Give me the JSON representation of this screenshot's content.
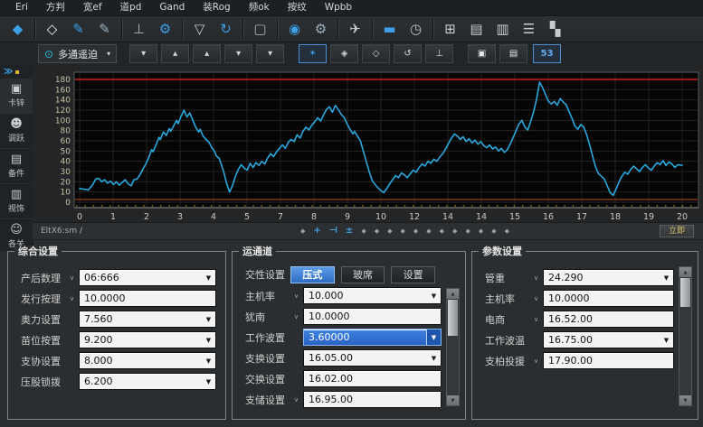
{
  "menu": {
    "items": [
      "Eri",
      "方判",
      "宽ef",
      "道pd",
      "Gand",
      "装Rog",
      "频ok",
      "按纹",
      "Wpbb"
    ]
  },
  "toolbar_main": {
    "items": [
      {
        "name": "app-home-button",
        "icon": "diamond-solid-icon",
        "glyph": "◆",
        "color": "#3d9fe6"
      },
      {
        "sep": true
      },
      {
        "name": "select-tool-button",
        "icon": "diamond-outline-icon",
        "glyph": "◇",
        "color": "#e8ebed"
      },
      {
        "name": "edit-pen-button",
        "icon": "pen-icon",
        "glyph": "✎",
        "color": "#3d9fe6"
      },
      {
        "name": "annotate-pen-button",
        "icon": "pen-icon",
        "glyph": "✎",
        "color": "#9fb2bf"
      },
      {
        "sep": true
      },
      {
        "name": "probe-tool-button",
        "icon": "probe-icon",
        "glyph": "⊥",
        "color": "#aab6be"
      },
      {
        "name": "gear-settings-button",
        "icon": "gear-icon",
        "glyph": "⚙",
        "color": "#3d9fe6"
      },
      {
        "sep": true
      },
      {
        "name": "shield-button",
        "icon": "shield-icon",
        "glyph": "▽",
        "color": "#c6cdd2"
      },
      {
        "name": "refresh-button",
        "icon": "refresh-icon",
        "glyph": "↻",
        "color": "#3d9fe6"
      },
      {
        "sep": true
      },
      {
        "name": "monitor-button",
        "icon": "monitor-icon",
        "glyph": "▢",
        "color": "#9fb2bf"
      },
      {
        "sep": true
      },
      {
        "name": "snapshot-button",
        "icon": "camera-icon",
        "glyph": "◉",
        "color": "#3d9fe6"
      },
      {
        "name": "wrench-button",
        "icon": "wrench-icon",
        "glyph": "⚙",
        "color": "#9fb2bf"
      },
      {
        "sep": true
      },
      {
        "name": "flight-button",
        "icon": "plane-icon",
        "glyph": "✈",
        "color": "#c6cdd2"
      },
      {
        "sep": true
      },
      {
        "name": "card-button",
        "icon": "card-icon",
        "glyph": "▬",
        "color": "#3d9fe6"
      },
      {
        "name": "clock-button",
        "icon": "clock-icon",
        "glyph": "◷",
        "color": "#b9c2c8"
      },
      {
        "sep": true
      },
      {
        "name": "calendar-button",
        "icon": "calendar-icon",
        "glyph": "⊞",
        "color": "#c6cdd2"
      },
      {
        "name": "document-button",
        "icon": "document-icon",
        "glyph": "▤",
        "color": "#c6cdd2"
      },
      {
        "name": "report-button",
        "icon": "report-icon",
        "glyph": "▥",
        "color": "#c6cdd2"
      },
      {
        "name": "list-menu-button",
        "icon": "hamburger-icon",
        "glyph": "☰",
        "color": "#c6cdd2"
      },
      {
        "name": "layout-grid-button",
        "icon": "blocks-icon",
        "glyph": "▚",
        "color": "#c6cdd2"
      }
    ]
  },
  "toolbar_chart": {
    "combo_icon": "pin-circle-icon",
    "combo_label": "多通遥迫",
    "items": [
      {
        "name": "chevron-down-button-1",
        "icon": "chevron-down-icon",
        "glyph": "▾",
        "color": "#cfd6da"
      },
      {
        "name": "marker-up-button",
        "icon": "arrow-up-icon",
        "glyph": "▴",
        "color": "#cfd6da"
      },
      {
        "name": "marker-top-button",
        "icon": "arrow-up-icon",
        "glyph": "▴",
        "color": "#cfd6da"
      },
      {
        "name": "chevron-down-button-2",
        "icon": "chevron-down-icon",
        "glyph": "▾",
        "color": "#cfd6da"
      },
      {
        "name": "chevron-down-button-3",
        "icon": "chevron-down-icon",
        "glyph": "▾",
        "color": "#cfd6da"
      },
      {
        "gap": true
      },
      {
        "name": "burst-tool-button",
        "icon": "burst-icon",
        "glyph": "✶",
        "color": "#3d9fe6",
        "active": true
      },
      {
        "name": "diamond-marker-button",
        "icon": "diamond-dot-icon",
        "glyph": "◈",
        "color": "#cfd6da"
      },
      {
        "name": "diamond-outline-button",
        "icon": "diamond-outline-icon",
        "glyph": "◇",
        "color": "#cfd6da"
      },
      {
        "name": "rotate-ccw-button",
        "icon": "rotate-ccw-icon",
        "glyph": "↺",
        "color": "#cfd6da"
      },
      {
        "name": "ground-button",
        "icon": "ground-icon",
        "glyph": "⊥",
        "color": "#cfd6da"
      },
      {
        "gap": true
      },
      {
        "name": "window-mode-button",
        "icon": "window-icon",
        "glyph": "▣",
        "color": "#e2e5e7"
      },
      {
        "name": "panel-mode-button",
        "icon": "panel-icon",
        "glyph": "▤",
        "color": "#e2e5e7"
      }
    ],
    "badge_label": "53",
    "badge_color": "#5fa9ef"
  },
  "sidebar": {
    "expander_blue": "≫",
    "expander_yellow": "▪",
    "items": [
      {
        "icon": "lock-icon",
        "glyph": "▣",
        "label": "卡锌"
      },
      {
        "icon": "user-icon",
        "glyph": "☻",
        "label": "调跃"
      },
      {
        "icon": "card-icon",
        "glyph": "▤",
        "label": "备件"
      },
      {
        "icon": "news-icon",
        "glyph": "▥",
        "label": "视饰"
      },
      {
        "icon": "person-icon",
        "glyph": "☺",
        "label": "各关"
      }
    ]
  },
  "chart_data": {
    "type": "line",
    "title": "",
    "xlabel": "",
    "ylabel": "",
    "x_ticks": [
      "0",
      "1",
      "2",
      "3",
      "4",
      "5",
      "7",
      "8",
      "9",
      "10",
      "12",
      "14",
      "14",
      "15",
      "16",
      "17",
      "18",
      "19",
      "20"
    ],
    "y_ticks": [
      "180",
      "160",
      "140",
      "120",
      "100",
      "80",
      "60",
      "50",
      "40",
      "30",
      "20",
      "10",
      "0"
    ],
    "x_domain": [
      0,
      20.5
    ],
    "y_domain": [
      0,
      190
    ],
    "grid": true,
    "legend": "none",
    "line_color": "#2aa7dd",
    "threshold_high": 180,
    "threshold_high_color": "#c8221a",
    "threshold_low": 4,
    "threshold_low_color": "#8f3a18",
    "minor_tick_color": "#b9861e",
    "points": [
      [
        0,
        20
      ],
      [
        0.15,
        19
      ],
      [
        0.3,
        18
      ],
      [
        0.45,
        26
      ],
      [
        0.55,
        34
      ],
      [
        0.65,
        35
      ],
      [
        0.75,
        30
      ],
      [
        0.85,
        33
      ],
      [
        0.95,
        28
      ],
      [
        1.05,
        31
      ],
      [
        1.15,
        26
      ],
      [
        1.25,
        30
      ],
      [
        1.35,
        25
      ],
      [
        1.45,
        29
      ],
      [
        1.55,
        33
      ],
      [
        1.65,
        27
      ],
      [
        1.75,
        24
      ],
      [
        1.85,
        33
      ],
      [
        1.95,
        34
      ],
      [
        2.05,
        40
      ],
      [
        2.15,
        48
      ],
      [
        2.25,
        56
      ],
      [
        2.35,
        65
      ],
      [
        2.45,
        77
      ],
      [
        2.5,
        74
      ],
      [
        2.6,
        84
      ],
      [
        2.7,
        95
      ],
      [
        2.75,
        92
      ],
      [
        2.85,
        103
      ],
      [
        2.95,
        98
      ],
      [
        3.05,
        108
      ],
      [
        3.1,
        104
      ],
      [
        3.2,
        112
      ],
      [
        3.3,
        120
      ],
      [
        3.35,
        115
      ],
      [
        3.45,
        126
      ],
      [
        3.55,
        135
      ],
      [
        3.65,
        125
      ],
      [
        3.75,
        131
      ],
      [
        3.85,
        120
      ],
      [
        3.95,
        110
      ],
      [
        4.05,
        103
      ],
      [
        4.1,
        107
      ],
      [
        4.2,
        97
      ],
      [
        4.3,
        92
      ],
      [
        4.4,
        88
      ],
      [
        4.5,
        80
      ],
      [
        4.6,
        74
      ],
      [
        4.65,
        68
      ],
      [
        4.75,
        64
      ],
      [
        4.8,
        58
      ],
      [
        4.9,
        45
      ],
      [
        5.0,
        28
      ],
      [
        5.1,
        15
      ],
      [
        5.2,
        24
      ],
      [
        5.3,
        38
      ],
      [
        5.4,
        48
      ],
      [
        5.5,
        55
      ],
      [
        5.6,
        50
      ],
      [
        5.7,
        47
      ],
      [
        5.8,
        57
      ],
      [
        5.9,
        51
      ],
      [
        6.0,
        58
      ],
      [
        6.1,
        54
      ],
      [
        6.2,
        60
      ],
      [
        6.3,
        56
      ],
      [
        6.4,
        65
      ],
      [
        6.5,
        71
      ],
      [
        6.6,
        67
      ],
      [
        6.7,
        74
      ],
      [
        6.8,
        79
      ],
      [
        6.9,
        84
      ],
      [
        7.0,
        79
      ],
      [
        7.1,
        88
      ],
      [
        7.2,
        92
      ],
      [
        7.3,
        89
      ],
      [
        7.4,
        99
      ],
      [
        7.5,
        94
      ],
      [
        7.6,
        104
      ],
      [
        7.7,
        110
      ],
      [
        7.8,
        106
      ],
      [
        7.9,
        113
      ],
      [
        8.0,
        118
      ],
      [
        8.1,
        124
      ],
      [
        8.2,
        119
      ],
      [
        8.3,
        128
      ],
      [
        8.4,
        136
      ],
      [
        8.5,
        140
      ],
      [
        8.6,
        132
      ],
      [
        8.7,
        142
      ],
      [
        8.8,
        136
      ],
      [
        8.9,
        129
      ],
      [
        9.0,
        124
      ],
      [
        9.1,
        115
      ],
      [
        9.2,
        107
      ],
      [
        9.3,
        100
      ],
      [
        9.35,
        104
      ],
      [
        9.45,
        97
      ],
      [
        9.55,
        90
      ],
      [
        9.65,
        75
      ],
      [
        9.75,
        60
      ],
      [
        9.85,
        45
      ],
      [
        9.95,
        32
      ],
      [
        10.05,
        26
      ],
      [
        10.15,
        21
      ],
      [
        10.25,
        17
      ],
      [
        10.35,
        14
      ],
      [
        10.45,
        20
      ],
      [
        10.55,
        27
      ],
      [
        10.65,
        33
      ],
      [
        10.75,
        39
      ],
      [
        10.85,
        36
      ],
      [
        10.95,
        43
      ],
      [
        11.05,
        40
      ],
      [
        11.15,
        36
      ],
      [
        11.25,
        42
      ],
      [
        11.35,
        47
      ],
      [
        11.45,
        44
      ],
      [
        11.55,
        51
      ],
      [
        11.65,
        56
      ],
      [
        11.75,
        53
      ],
      [
        11.85,
        60
      ],
      [
        11.95,
        57
      ],
      [
        12.05,
        63
      ],
      [
        12.15,
        60
      ],
      [
        12.25,
        66
      ],
      [
        12.35,
        71
      ],
      [
        12.45,
        78
      ],
      [
        12.55,
        86
      ],
      [
        12.65,
        94
      ],
      [
        12.75,
        100
      ],
      [
        12.85,
        97
      ],
      [
        12.95,
        92
      ],
      [
        13.05,
        96
      ],
      [
        13.15,
        89
      ],
      [
        13.25,
        93
      ],
      [
        13.35,
        87
      ],
      [
        13.45,
        91
      ],
      [
        13.55,
        85
      ],
      [
        13.65,
        89
      ],
      [
        13.75,
        83
      ],
      [
        13.85,
        80
      ],
      [
        13.95,
        84
      ],
      [
        14.05,
        78
      ],
      [
        14.15,
        81
      ],
      [
        14.25,
        75
      ],
      [
        14.35,
        79
      ],
      [
        14.45,
        73
      ],
      [
        14.55,
        77
      ],
      [
        14.65,
        85
      ],
      [
        14.75,
        95
      ],
      [
        14.85,
        105
      ],
      [
        14.95,
        115
      ],
      [
        15.05,
        120
      ],
      [
        15.15,
        110
      ],
      [
        15.25,
        106
      ],
      [
        15.35,
        119
      ],
      [
        15.45,
        133
      ],
      [
        15.55,
        152
      ],
      [
        15.65,
        176
      ],
      [
        15.75,
        168
      ],
      [
        15.85,
        158
      ],
      [
        15.95,
        148
      ],
      [
        16.05,
        144
      ],
      [
        16.15,
        148
      ],
      [
        16.25,
        142
      ],
      [
        16.35,
        152
      ],
      [
        16.45,
        147
      ],
      [
        16.55,
        143
      ],
      [
        16.65,
        133
      ],
      [
        16.75,
        123
      ],
      [
        16.85,
        112
      ],
      [
        16.95,
        107
      ],
      [
        17.05,
        114
      ],
      [
        17.15,
        110
      ],
      [
        17.25,
        99
      ],
      [
        17.35,
        84
      ],
      [
        17.45,
        68
      ],
      [
        17.55,
        52
      ],
      [
        17.65,
        42
      ],
      [
        17.75,
        38
      ],
      [
        17.85,
        34
      ],
      [
        17.95,
        24
      ],
      [
        18.05,
        14
      ],
      [
        18.15,
        10
      ],
      [
        18.25,
        19
      ],
      [
        18.35,
        30
      ],
      [
        18.45,
        38
      ],
      [
        18.55,
        44
      ],
      [
        18.65,
        41
      ],
      [
        18.75,
        48
      ],
      [
        18.85,
        53
      ],
      [
        18.95,
        49
      ],
      [
        19.05,
        45
      ],
      [
        19.15,
        51
      ],
      [
        19.25,
        55
      ],
      [
        19.35,
        50
      ],
      [
        19.45,
        47
      ],
      [
        19.55,
        53
      ],
      [
        19.65,
        58
      ],
      [
        19.75,
        55
      ],
      [
        19.85,
        61
      ],
      [
        19.95,
        54
      ],
      [
        20.05,
        59
      ],
      [
        20.15,
        56
      ],
      [
        20.25,
        51
      ],
      [
        20.35,
        55
      ],
      [
        20.5,
        54
      ]
    ]
  },
  "chart_footer": {
    "left_text": "EltX6:sm /",
    "markers": [
      {
        "glyph": "◆",
        "blue": false
      },
      {
        "glyph": "+",
        "blue": true
      },
      {
        "glyph": "⊣",
        "blue": true
      },
      {
        "glyph": "±",
        "blue": true
      },
      {
        "glyph": "◆",
        "blue": false
      },
      {
        "glyph": "◆",
        "blue": false
      },
      {
        "glyph": "◆",
        "blue": false
      },
      {
        "glyph": "◆",
        "blue": false
      },
      {
        "glyph": "◆",
        "blue": false
      },
      {
        "glyph": "◆",
        "blue": false
      },
      {
        "glyph": "◆",
        "blue": false
      },
      {
        "glyph": "◆",
        "blue": false
      },
      {
        "glyph": "◆",
        "blue": false
      },
      {
        "glyph": "◆",
        "blue": false
      },
      {
        "glyph": "◆",
        "blue": false
      },
      {
        "glyph": "◆",
        "blue": false
      }
    ],
    "action_label": "立即"
  },
  "panels": [
    {
      "title": "综合设置",
      "rows": [
        {
          "label": "产后数理",
          "chev": true,
          "value": "06:666",
          "arrow": true
        },
        {
          "label": "发行按理",
          "chev": true,
          "value": "10.0000",
          "arrow": false
        },
        {
          "label": "奥力设置",
          "chev": false,
          "value": "7.560",
          "arrow": true
        },
        {
          "label": "苗位按置",
          "chev": false,
          "value": "9.200",
          "arrow": true
        },
        {
          "label": "支协设置",
          "chev": false,
          "value": "8.000",
          "arrow": true
        },
        {
          "label": "压股锁拨",
          "chev": false,
          "value": "6.200",
          "arrow": true
        }
      ],
      "scrollbar": false
    },
    {
      "title": "运通道",
      "tabs_row": {
        "label": "交性设置",
        "tabs": [
          "压式",
          "玻席",
          "设置"
        ],
        "selected": 0
      },
      "rows": [
        {
          "label": "主机率",
          "chev": true,
          "value": "10.000",
          "arrow": true
        },
        {
          "label": "犹南",
          "chev": true,
          "value": "10.0000",
          "arrow": false
        },
        {
          "label": "工作波置",
          "chev": false,
          "value": "3.60000",
          "arrow": true,
          "selected": true
        },
        {
          "label": "支换设置",
          "chev": false,
          "value": "16.05.00",
          "arrow": true
        },
        {
          "label": "交换设置",
          "chev": false,
          "value": "16.02.00",
          "arrow": false
        },
        {
          "label": "支储设置",
          "chev": true,
          "value": "16.95.00",
          "arrow": false
        }
      ],
      "scrollbar": true
    },
    {
      "title": "参数设置",
      "rows": [
        {
          "label": "管重",
          "chev": true,
          "value": "24.290",
          "arrow": true
        },
        {
          "label": "主机率",
          "chev": true,
          "value": "10.0000",
          "arrow": false
        },
        {
          "label": "电商",
          "chev": true,
          "value": "16.52.00",
          "arrow": false
        },
        {
          "label": "工作波温",
          "chev": false,
          "value": "16.75.00",
          "arrow": true
        },
        {
          "label": "支柏投援",
          "chev": true,
          "value": "17.90.00",
          "arrow": false
        }
      ],
      "scrollbar": true
    }
  ]
}
